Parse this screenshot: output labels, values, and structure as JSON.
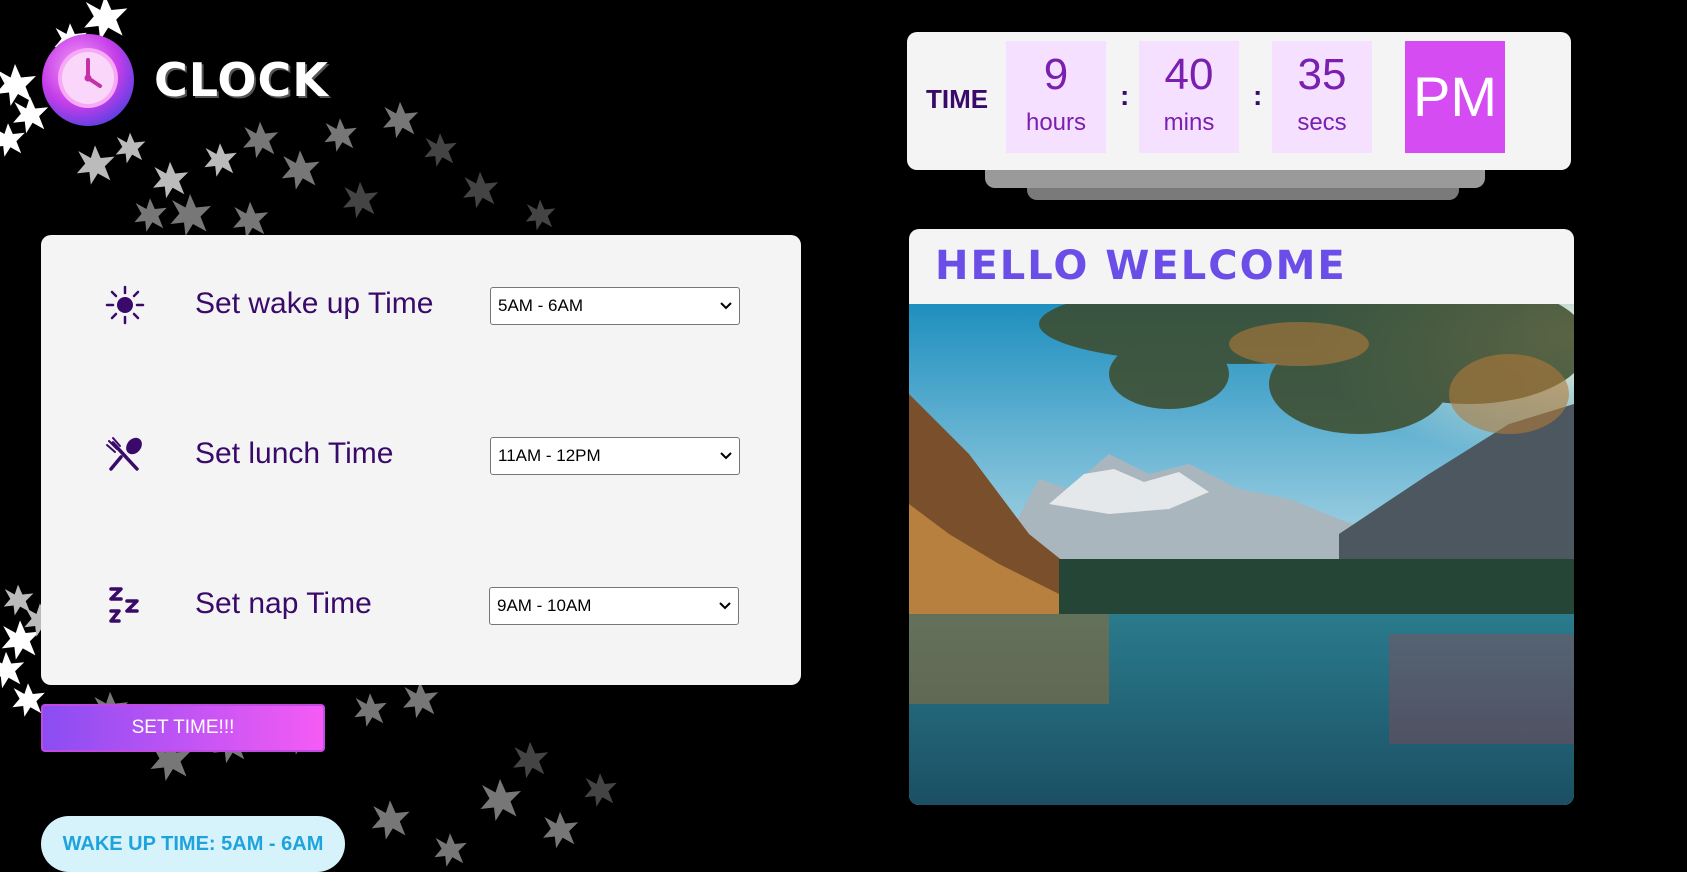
{
  "logo": {
    "text": "CLOCK"
  },
  "clock": {
    "label": "TIME",
    "hours": "9",
    "hours_unit": "hours",
    "mins": "40",
    "mins_unit": "mins",
    "secs": "35",
    "secs_unit": "secs",
    "separator": ":",
    "ampm": "PM"
  },
  "settings": {
    "rows": [
      {
        "label": "Set wake up Time",
        "value": "5AM - 6AM",
        "icon": "sun-icon"
      },
      {
        "label": "Set lunch Time",
        "value": "11AM - 12PM",
        "icon": "utensils-icon"
      },
      {
        "label": "Set nap Time",
        "value": "9AM - 10AM",
        "icon": "sleep-zzz-icon"
      }
    ]
  },
  "set_button": {
    "label": "SET TIME!!!"
  },
  "status": {
    "wake_up_text": "WAKE UP TIME: 5AM - 6AM"
  },
  "welcome": {
    "title": "HELLO WELCOME",
    "image": "lake-mountain-landscape"
  },
  "colors": {
    "accent_purple": "#3a0a6a",
    "ampm_bg": "#d44cf2",
    "welcome_title": "#6b4ee8",
    "badge_text": "#1fa3dc"
  }
}
